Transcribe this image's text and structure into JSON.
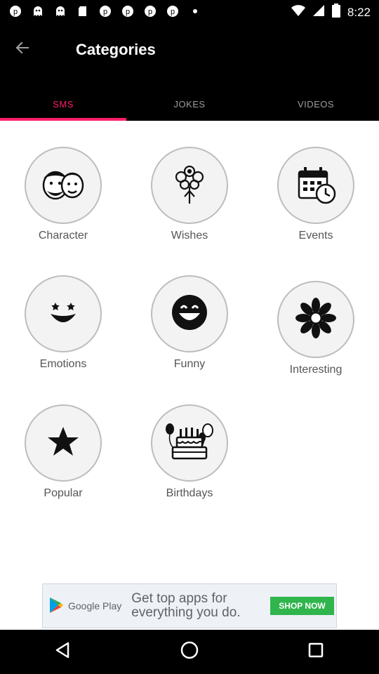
{
  "status_bar": {
    "time": "8:22",
    "notification_icons": [
      "p-icon",
      "ghost-icon",
      "ghost-icon",
      "sd-card-icon",
      "p-icon",
      "p-icon",
      "p-icon",
      "p-icon",
      "dot-icon"
    ],
    "right_icons": [
      "wifi-icon",
      "signal-icon",
      "battery-icon"
    ]
  },
  "app_bar": {
    "title": "Categories"
  },
  "tabs": [
    {
      "label": "SMS",
      "active": true
    },
    {
      "label": "JOKES",
      "active": false
    },
    {
      "label": "VIDEOS",
      "active": false
    }
  ],
  "categories": [
    {
      "label": "Character",
      "icon": "character-icon"
    },
    {
      "label": "Wishes",
      "icon": "flower-bouquet-icon"
    },
    {
      "label": "Events",
      "icon": "calendar-clock-icon"
    },
    {
      "label": "Emotions",
      "icon": "smiley-face-icon"
    },
    {
      "label": "Funny",
      "icon": "laughing-face-icon"
    },
    {
      "label": "Interesting",
      "icon": "flower-icon"
    },
    {
      "label": "Popular",
      "icon": "star-icon"
    },
    {
      "label": "Birthdays",
      "icon": "birthday-cake-icon"
    }
  ],
  "ad": {
    "brand": "Google Play",
    "text": "Get top apps for everything you do.",
    "cta": "SHOP NOW"
  },
  "colors": {
    "accent": "#ff1f6b",
    "bar_bg": "#000000",
    "tab_inactive": "#9e9e9e"
  }
}
